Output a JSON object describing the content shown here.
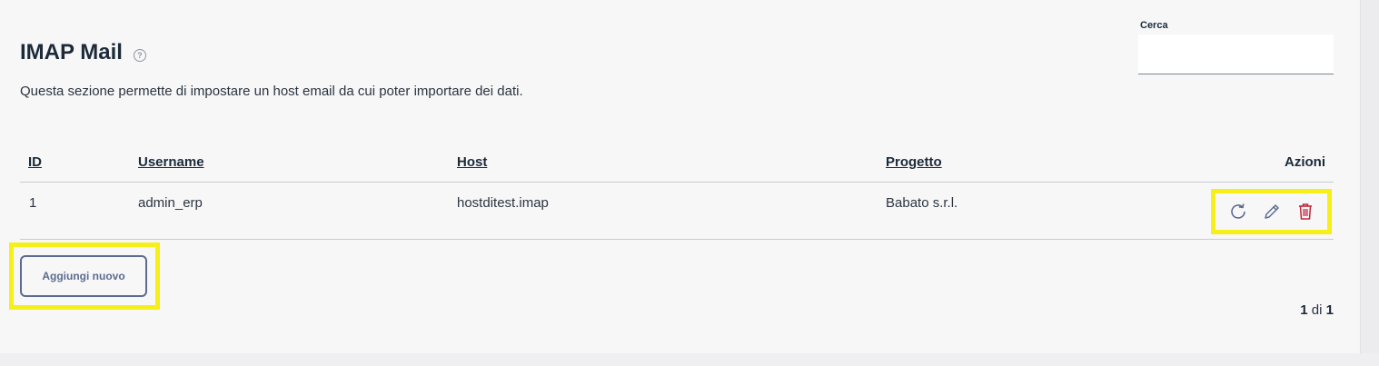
{
  "header": {
    "title": "IMAP Mail",
    "help_icon": "?",
    "description": "Questa sezione permette di impostare un host email da cui poter importare dei dati."
  },
  "search": {
    "label": "Cerca",
    "value": "",
    "placeholder": ""
  },
  "table": {
    "columns": {
      "id": "ID",
      "username": "Username",
      "host": "Host",
      "project": "Progetto",
      "actions": "Azioni"
    },
    "rows": [
      {
        "id": "1",
        "username": "admin_erp",
        "host": "hostditest.imap",
        "project": "Babato s.r.l."
      }
    ],
    "action_icons": [
      "refresh-icon",
      "pencil-icon",
      "trash-icon"
    ],
    "colors": {
      "action_icon": "#5c6b8e",
      "delete_icon": "#c0283a"
    }
  },
  "add_button": {
    "label": "Aggiungi nuovo"
  },
  "pagination": {
    "current": "1",
    "separator": "di",
    "total": "1"
  },
  "highlight_color": "#f6ef1a"
}
